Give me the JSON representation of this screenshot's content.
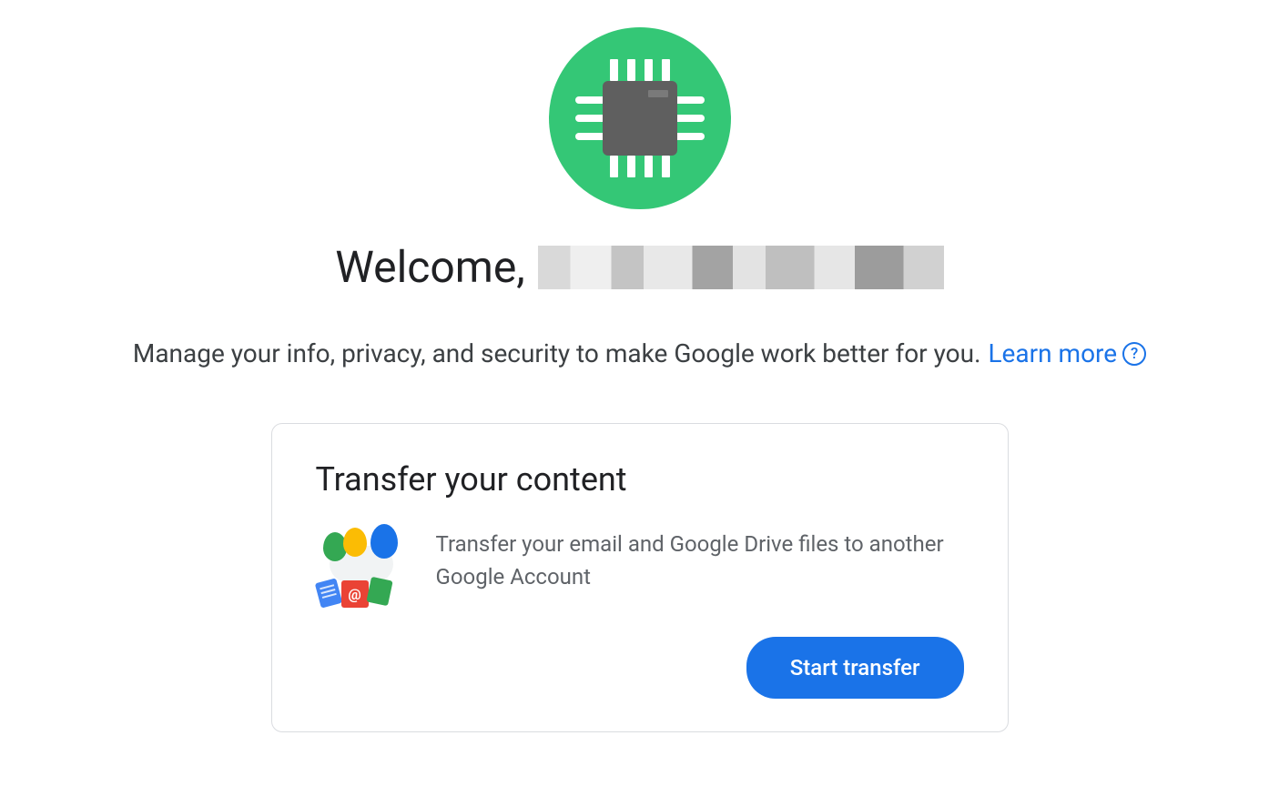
{
  "header": {
    "welcome_prefix": "Welcome,",
    "subtitle": "Manage your info, privacy, and security to make Google work better for you.",
    "learn_more_label": "Learn more",
    "help_icon_glyph": "?"
  },
  "card": {
    "title": "Transfer your content",
    "description": "Transfer your email and Google Drive files to another Google Account",
    "button_label": "Start transfer",
    "at_icon": "@"
  },
  "colors": {
    "primary": "#1a73e8",
    "avatar_bg": "#34c776"
  }
}
